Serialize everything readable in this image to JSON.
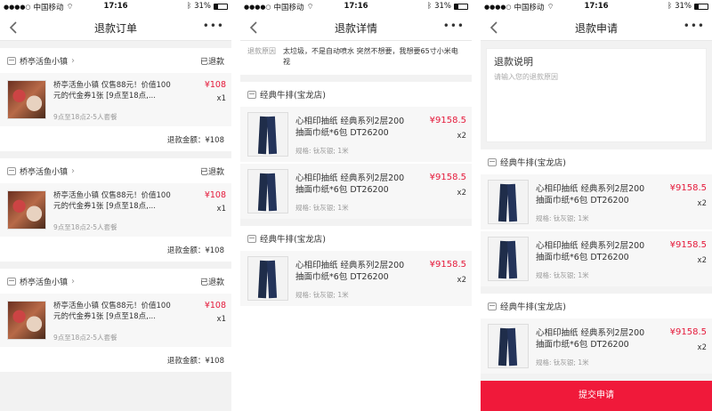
{
  "statusbar": {
    "carrier": "中国移动",
    "time": "17:16",
    "battery": "31%"
  },
  "screen1": {
    "title": "退款订单",
    "orders": [
      {
        "shop": "桥亭活鱼小镇",
        "status": "已退款",
        "name": "桥亭活鱼小镇 仅售88元！价值100元的代金券1张 [9点至18点,...",
        "spec": "9点至18点2-5人套餐",
        "price": "¥108",
        "qty": "x1",
        "refund": "退款金额：¥108"
      },
      {
        "shop": "桥亭活鱼小镇",
        "status": "已退款",
        "name": "桥亭活鱼小镇 仅售88元！价值100元的代金券1张 [9点至18点,...",
        "spec": "9点至18点2-5人套餐",
        "price": "¥108",
        "qty": "x1",
        "refund": "退款金额：¥108"
      },
      {
        "shop": "桥亭活鱼小镇",
        "status": "已退款",
        "name": "桥亭活鱼小镇 仅售88元！价值100元的代金券1张 [9点至18点,...",
        "spec": "9点至18点2-5人套餐",
        "price": "¥108",
        "qty": "x1",
        "refund": "退款金额：¥108"
      }
    ]
  },
  "screen2": {
    "title": "退款详情",
    "reason_label": "退款原因",
    "reason_value": "太垃圾，不是自动喷水  突然不想要，我想要65寸小米电视",
    "shops": [
      {
        "name": "经典牛排(宝龙店)",
        "items": [
          {
            "name": "心相印抽纸 经典系列2层200抽面巾纸*6包 DT26200",
            "spec": "规格: 钛灰银; 1米",
            "price": "¥9158.5",
            "qty": "x2"
          },
          {
            "name": "心相印抽纸 经典系列2层200抽面巾纸*6包 DT26200",
            "spec": "规格: 钛灰银; 1米",
            "price": "¥9158.5",
            "qty": "x2"
          }
        ]
      },
      {
        "name": "经典牛排(宝龙店)",
        "items": [
          {
            "name": "心相印抽纸 经典系列2层200抽面巾纸*6包 DT26200",
            "spec": "规格: 钛灰银; 1米",
            "price": "¥9158.5",
            "qty": "x2"
          }
        ]
      }
    ]
  },
  "screen3": {
    "title": "退款申请",
    "explain_title": "退款说明",
    "explain_placeholder": "请输入您的退款原因",
    "shops": [
      {
        "name": "经典牛排(宝龙店)",
        "items": [
          {
            "name": "心相印抽纸 经典系列2层200抽面巾纸*6包 DT26200",
            "spec": "规格: 钛灰银; 1米",
            "price": "¥9158.5",
            "qty": "x2"
          },
          {
            "name": "心相印抽纸 经典系列2层200抽面巾纸*6包 DT26200",
            "spec": "规格: 钛灰银; 1米",
            "price": "¥9158.5",
            "qty": "x2"
          }
        ]
      },
      {
        "name": "经典牛排(宝龙店)",
        "items": [
          {
            "name": "心相印抽纸 经典系列2层200抽面巾纸*6包 DT26200",
            "spec": "规格: 钛灰银; 1米",
            "price": "¥9158.5",
            "qty": "x2"
          }
        ]
      }
    ],
    "submit": "提交申请"
  },
  "colors": {
    "accent": "#f0193a",
    "price": "#e5193a",
    "background": "#f2f2f2"
  },
  "icons": [
    "back-arrow-icon",
    "more-icon",
    "shop-icon",
    "chevron-right-icon",
    "wifi-icon",
    "bluetooth-icon",
    "battery-icon"
  ]
}
